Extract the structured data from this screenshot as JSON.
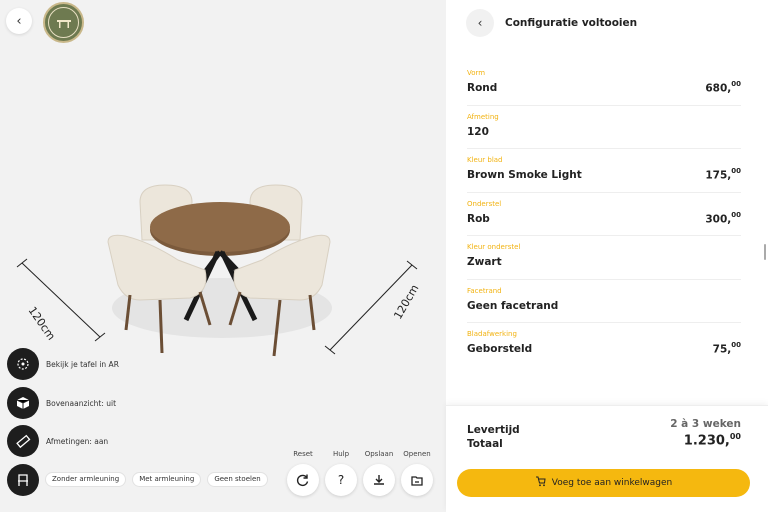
{
  "viewer": {
    "logo_text": "TAFELBOERTJE TAFELS EN MEER",
    "dimension_left": "120cm",
    "dimension_right": "120cm",
    "tools": [
      {
        "icon": "ar-icon",
        "label": "Bekijk je tafel in AR"
      },
      {
        "icon": "cube-icon",
        "label": "Bovenaanzicht: uit"
      },
      {
        "icon": "ruler-icon",
        "label": "Afmetingen: aan"
      },
      {
        "icon": "chair-icon",
        "label": ""
      }
    ],
    "chips": [
      "Zonder armleuning",
      "Met armleuning",
      "Geen stoelen"
    ],
    "actions": [
      {
        "label": "Reset",
        "icon": "refresh-icon"
      },
      {
        "label": "Hulp",
        "icon": "help-icon"
      },
      {
        "label": "Opslaan",
        "icon": "download-icon"
      },
      {
        "label": "Openen",
        "icon": "open-folder-icon"
      }
    ]
  },
  "panel": {
    "title": "Configuratie voltooien",
    "rows": [
      {
        "key": "Vorm",
        "value": "Rond",
        "price_main": "680,",
        "price_cents": "00"
      },
      {
        "key": "Afmeting",
        "value": "120",
        "price_main": "",
        "price_cents": ""
      },
      {
        "key": "Kleur blad",
        "value": "Brown Smoke Light",
        "price_main": "175,",
        "price_cents": "00"
      },
      {
        "key": "Onderstel",
        "value": "Rob",
        "price_main": "300,",
        "price_cents": "00"
      },
      {
        "key": "Kleur onderstel",
        "value": "Zwart",
        "price_main": "",
        "price_cents": ""
      },
      {
        "key": "Facetrand",
        "value": "Geen facetrand",
        "price_main": "",
        "price_cents": ""
      },
      {
        "key": "Bladafwerking",
        "value": "Geborsteld",
        "price_main": "75,",
        "price_cents": "00"
      }
    ],
    "summary": {
      "lever_label": "Levertijd",
      "lever_value": "2 à 3 weken",
      "total_label": "Totaal",
      "total_main": "1.230,",
      "total_cents": "00"
    },
    "cart_button": "Voeg toe aan winkelwagen"
  },
  "colors": {
    "accent": "#f5b80f",
    "label": "#f2b312",
    "dark": "#1e1e1e"
  }
}
